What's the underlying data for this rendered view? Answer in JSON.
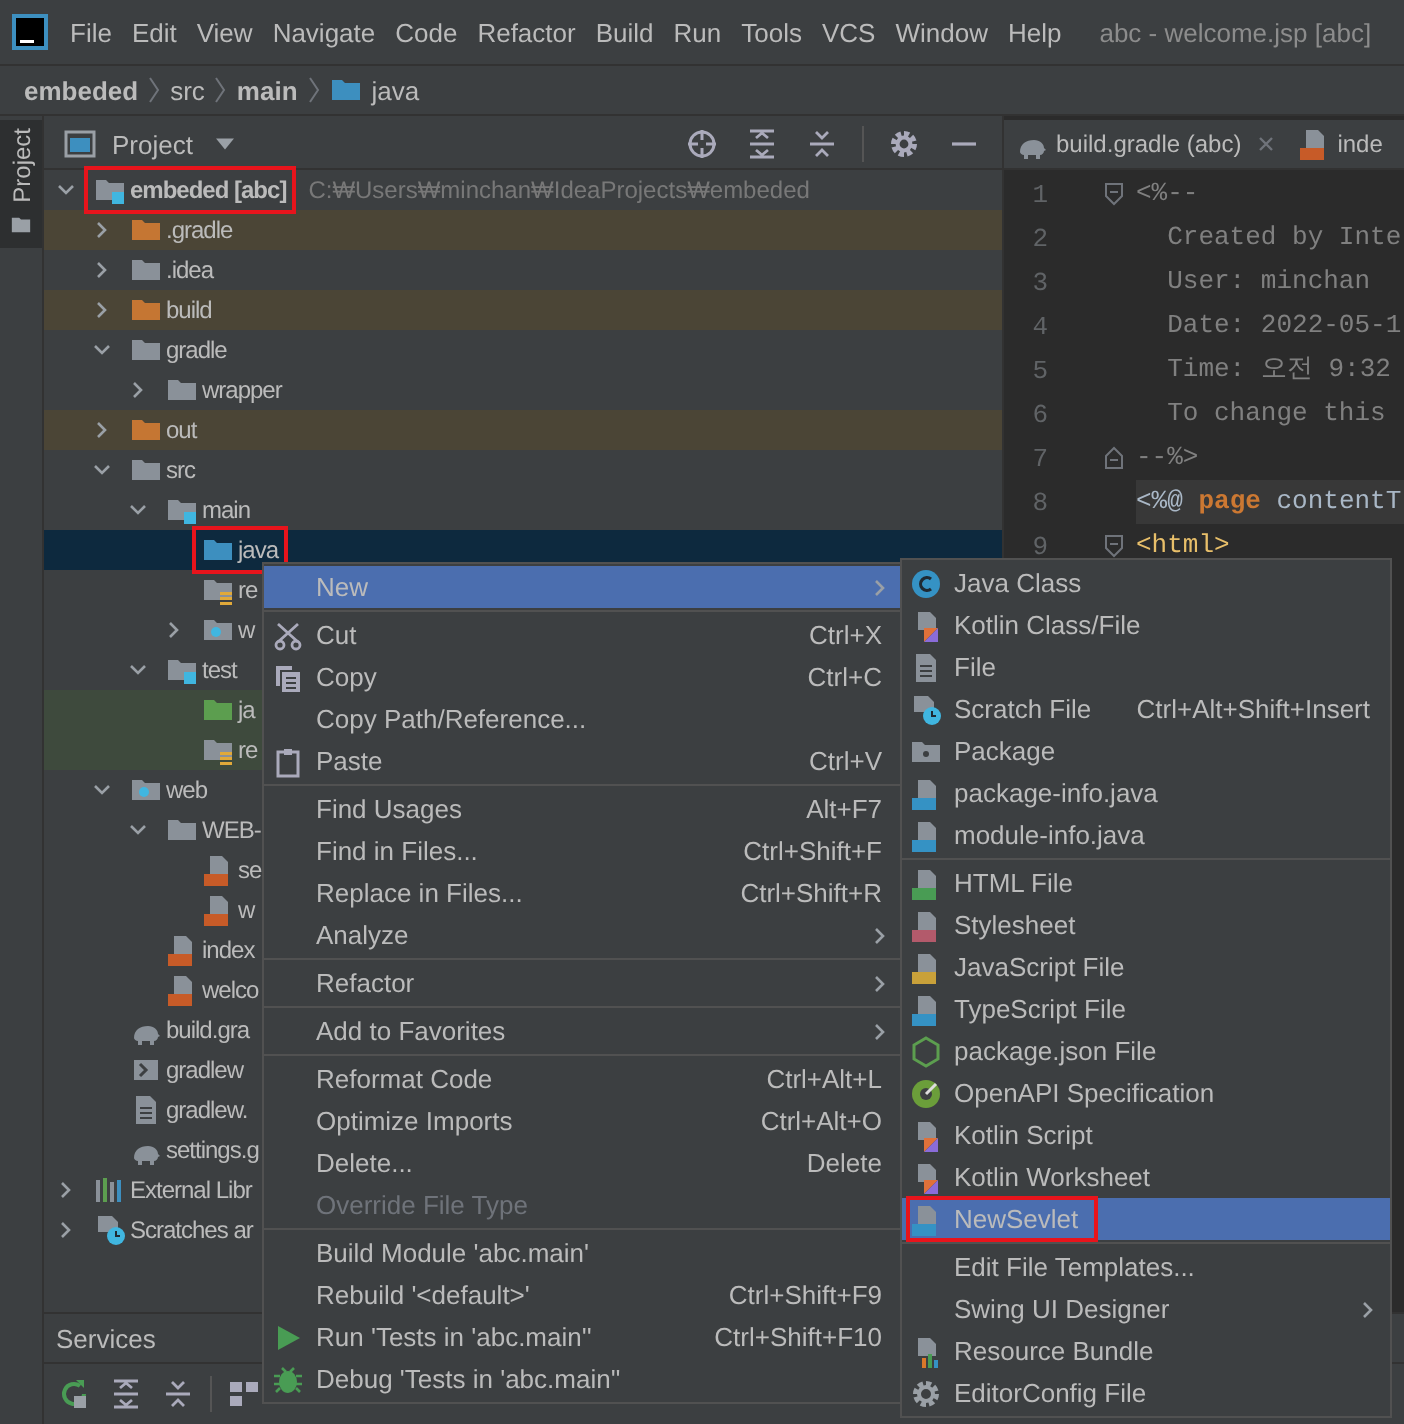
{
  "menu_bar": {
    "items": [
      "File",
      "Edit",
      "View",
      "Navigate",
      "Code",
      "Refactor",
      "Build",
      "Run",
      "Tools",
      "VCS",
      "Window",
      "Help"
    ],
    "window_title": "abc - welcome.jsp [abc]"
  },
  "breadcrumbs": [
    {
      "label": "embeded",
      "kind": "module"
    },
    {
      "label": "src",
      "kind": "folder"
    },
    {
      "label": "main",
      "kind": "module"
    },
    {
      "label": "java",
      "kind": "source-folder"
    }
  ],
  "tool_stripe": {
    "tabs": [
      {
        "label": "Project",
        "selected": true
      }
    ]
  },
  "project_panel": {
    "title": "Project",
    "tree": [
      {
        "label": "embeded [abc]",
        "path": "C:₩Users₩minchan₩IdeaProjects₩embeded",
        "kind": "module-folder",
        "expanded": true,
        "selected": false,
        "highlighted": true,
        "children": [
          {
            "label": ".gradle",
            "kind": "folder-excluded",
            "expanded": false,
            "selected": false,
            "highlighted": false
          },
          {
            "label": ".idea",
            "kind": "folder",
            "expanded": false,
            "selected": false,
            "highlighted": false
          },
          {
            "label": "build",
            "kind": "folder-excluded",
            "expanded": false,
            "selected": false,
            "highlighted": false
          },
          {
            "label": "gradle",
            "kind": "folder",
            "expanded": true,
            "selected": false,
            "highlighted": false,
            "children": [
              {
                "label": "wrapper",
                "kind": "folder",
                "expanded": false,
                "selected": false,
                "highlighted": false
              }
            ]
          },
          {
            "label": "out",
            "kind": "folder-excluded",
            "expanded": false,
            "selected": false,
            "highlighted": false
          },
          {
            "label": "src",
            "kind": "folder",
            "expanded": true,
            "selected": false,
            "highlighted": false,
            "children": [
              {
                "label": "main",
                "kind": "module-folder",
                "expanded": true,
                "selected": false,
                "highlighted": false,
                "children": [
                  {
                    "label": "java",
                    "kind": "source-folder",
                    "selected": true,
                    "highlighted": true
                  },
                  {
                    "label": "re",
                    "kind": "resources-folder",
                    "selected": false,
                    "highlighted": false
                  },
                  {
                    "label": "w",
                    "kind": "web-folder",
                    "expanded": false,
                    "selected": false,
                    "highlighted": false
                  }
                ]
              },
              {
                "label": "test",
                "kind": "module-folder",
                "expanded": true,
                "selected": false,
                "highlighted": false,
                "children": [
                  {
                    "label": "ja",
                    "kind": "test-folder",
                    "selected": false,
                    "highlighted": false
                  },
                  {
                    "label": "re",
                    "kind": "test-resources-folder",
                    "selected": false,
                    "highlighted": false
                  }
                ]
              }
            ]
          },
          {
            "label": "web",
            "kind": "web-folder",
            "expanded": true,
            "selected": false,
            "highlighted": false,
            "children": [
              {
                "label": "WEB-",
                "kind": "folder",
                "expanded": true,
                "selected": false,
                "highlighted": false,
                "children": [
                  {
                    "label": "se",
                    "kind": "xml-file",
                    "selected": false,
                    "highlighted": false
                  },
                  {
                    "label": "w",
                    "kind": "xml-file",
                    "selected": false,
                    "highlighted": false
                  }
                ]
              },
              {
                "label": "index",
                "kind": "jsp-file",
                "selected": false,
                "highlighted": false
              },
              {
                "label": "welco",
                "kind": "jsp-file",
                "selected": false,
                "highlighted": false
              }
            ]
          },
          {
            "label": "build.gra",
            "kind": "gradle-file",
            "selected": false,
            "highlighted": false
          },
          {
            "label": "gradlew",
            "kind": "script-file",
            "selected": false,
            "highlighted": false
          },
          {
            "label": "gradlew.",
            "kind": "text-file",
            "selected": false,
            "highlighted": false
          },
          {
            "label": "settings.g",
            "kind": "gradle-file",
            "selected": false,
            "highlighted": false
          }
        ]
      },
      {
        "label": "External Libr",
        "kind": "libraries",
        "expanded": false,
        "selected": false,
        "highlighted": false
      },
      {
        "label": "Scratches ar",
        "kind": "scratches",
        "expanded": false,
        "selected": false,
        "highlighted": false
      }
    ]
  },
  "editor": {
    "tabs": [
      {
        "label": "build.gradle (abc)",
        "kind": "gradle-file",
        "selected": false,
        "closable": true
      },
      {
        "label": "inde",
        "kind": "jsp-file",
        "selected": false,
        "closable": false
      }
    ],
    "lines": [
      {
        "number": "1",
        "kind": "fold-start",
        "current": false,
        "tokens": [
          {
            "text": "<%--",
            "kind": "comment"
          }
        ]
      },
      {
        "number": "2",
        "kind": "plain",
        "current": false,
        "tokens": [
          {
            "text": "  Created by Inte",
            "kind": "comment"
          }
        ]
      },
      {
        "number": "3",
        "kind": "plain",
        "current": false,
        "tokens": [
          {
            "text": "  User: minchan",
            "kind": "comment"
          }
        ]
      },
      {
        "number": "4",
        "kind": "plain",
        "current": false,
        "tokens": [
          {
            "text": "  Date: 2022-05-1",
            "kind": "comment"
          }
        ]
      },
      {
        "number": "5",
        "kind": "plain",
        "current": false,
        "tokens": [
          {
            "text": "  Time: 오전 9:32",
            "kind": "comment"
          }
        ]
      },
      {
        "number": "6",
        "kind": "plain",
        "current": false,
        "tokens": [
          {
            "text": "  To change this",
            "kind": "comment"
          }
        ]
      },
      {
        "number": "7",
        "kind": "fold-end",
        "current": false,
        "tokens": [
          {
            "text": "--%>",
            "kind": "comment"
          }
        ]
      },
      {
        "number": "8",
        "kind": "plain",
        "current": true,
        "tokens": [
          {
            "text": "<%@ ",
            "kind": "plain"
          },
          {
            "text": "page",
            "kind": "keyword"
          },
          {
            "text": " contentT",
            "kind": "plain"
          }
        ]
      },
      {
        "number": "9",
        "kind": "fold-start",
        "current": false,
        "tokens": [
          {
            "text": "<html>",
            "kind": "tag"
          }
        ]
      }
    ]
  },
  "services": {
    "title": "Services"
  },
  "context_menu": {
    "groups": [
      [
        {
          "label": "New",
          "selected": true,
          "disabled": false,
          "submenu": true
        }
      ],
      [
        {
          "label": "Cut",
          "kind": "cut",
          "shortcut": "Ctrl+X",
          "selected": false,
          "disabled": false,
          "submenu": false
        },
        {
          "label": "Copy",
          "kind": "copy",
          "shortcut": "Ctrl+C",
          "selected": false,
          "disabled": false,
          "submenu": false
        },
        {
          "label": "Copy Path/Reference...",
          "selected": false,
          "disabled": false,
          "submenu": false
        },
        {
          "label": "Paste",
          "kind": "paste",
          "shortcut": "Ctrl+V",
          "selected": false,
          "disabled": false,
          "submenu": false
        }
      ],
      [
        {
          "label": "Find Usages",
          "shortcut": "Alt+F7",
          "selected": false,
          "disabled": false,
          "submenu": false
        },
        {
          "label": "Find in Files...",
          "shortcut": "Ctrl+Shift+F",
          "selected": false,
          "disabled": false,
          "submenu": false
        },
        {
          "label": "Replace in Files...",
          "shortcut": "Ctrl+Shift+R",
          "selected": false,
          "disabled": false,
          "submenu": false
        },
        {
          "label": "Analyze",
          "selected": false,
          "disabled": false,
          "submenu": true
        }
      ],
      [
        {
          "label": "Refactor",
          "selected": false,
          "disabled": false,
          "submenu": true
        }
      ],
      [
        {
          "label": "Add to Favorites",
          "selected": false,
          "disabled": false,
          "submenu": true
        }
      ],
      [
        {
          "label": "Reformat Code",
          "shortcut": "Ctrl+Alt+L",
          "selected": false,
          "disabled": false,
          "submenu": false
        },
        {
          "label": "Optimize Imports",
          "shortcut": "Ctrl+Alt+O",
          "selected": false,
          "disabled": false,
          "submenu": false
        },
        {
          "label": "Delete...",
          "shortcut": "Delete",
          "selected": false,
          "disabled": false,
          "submenu": false
        },
        {
          "label": "Override File Type",
          "selected": false,
          "disabled": true,
          "submenu": false
        }
      ],
      [
        {
          "label": "Build Module 'abc.main'",
          "selected": false,
          "disabled": false,
          "submenu": false
        },
        {
          "label": "Rebuild '<default>'",
          "shortcut": "Ctrl+Shift+F9",
          "selected": false,
          "disabled": false,
          "submenu": false
        },
        {
          "label": "Run 'Tests in 'abc.main''",
          "kind": "run",
          "shortcut": "Ctrl+Shift+F10",
          "selected": false,
          "disabled": false,
          "submenu": false
        },
        {
          "label": "Debug 'Tests in 'abc.main''",
          "kind": "debug",
          "selected": false,
          "disabled": false,
          "submenu": false
        }
      ]
    ]
  },
  "new_submenu": {
    "groups": [
      [
        {
          "label": "Java Class",
          "kind": "java-class",
          "selected": false,
          "highlighted": false,
          "submenu": false
        },
        {
          "label": "Kotlin Class/File",
          "kind": "kotlin-file",
          "selected": false,
          "highlighted": false,
          "submenu": false
        },
        {
          "label": "File",
          "kind": "text-file",
          "selected": false,
          "highlighted": false,
          "submenu": false
        },
        {
          "label": "Scratch File",
          "kind": "scratch-file",
          "shortcut": "Ctrl+Alt+Shift+Insert",
          "selected": false,
          "highlighted": false,
          "submenu": false
        },
        {
          "label": "Package",
          "kind": "package",
          "selected": false,
          "highlighted": false,
          "submenu": false
        },
        {
          "label": "package-info.java",
          "kind": "java-file",
          "selected": false,
          "highlighted": false,
          "submenu": false
        },
        {
          "label": "module-info.java",
          "kind": "java-file",
          "selected": false,
          "highlighted": false,
          "submenu": false
        }
      ],
      [
        {
          "label": "HTML File",
          "kind": "html-file",
          "selected": false,
          "highlighted": false,
          "submenu": false
        },
        {
          "label": "Stylesheet",
          "kind": "css-file",
          "selected": false,
          "highlighted": false,
          "submenu": false
        },
        {
          "label": "JavaScript File",
          "kind": "js-file",
          "selected": false,
          "highlighted": false,
          "submenu": false
        },
        {
          "label": "TypeScript File",
          "kind": "ts-file",
          "selected": false,
          "highlighted": false,
          "submenu": false
        },
        {
          "label": "package.json File",
          "kind": "json-file",
          "selected": false,
          "highlighted": false,
          "submenu": false
        },
        {
          "label": "OpenAPI Specification",
          "kind": "openapi",
          "selected": false,
          "highlighted": false,
          "submenu": false
        },
        {
          "label": "Kotlin Script",
          "kind": "kotlin-file",
          "selected": false,
          "highlighted": false,
          "submenu": false
        },
        {
          "label": "Kotlin Worksheet",
          "kind": "kotlin-file",
          "selected": false,
          "highlighted": false,
          "submenu": false
        },
        {
          "label": "NewSevlet",
          "kind": "java-file",
          "selected": true,
          "highlighted": true,
          "submenu": false
        }
      ],
      [
        {
          "label": "Edit File Templates...",
          "selected": false,
          "highlighted": false,
          "submenu": false
        },
        {
          "label": "Swing UI Designer",
          "selected": false,
          "highlighted": false,
          "submenu": true
        },
        {
          "label": "Resource Bundle",
          "kind": "resource-bundle",
          "selected": false,
          "highlighted": false,
          "submenu": false
        },
        {
          "label": "EditorConfig File",
          "kind": "gear",
          "selected": false,
          "highlighted": false,
          "submenu": false
        }
      ]
    ]
  }
}
